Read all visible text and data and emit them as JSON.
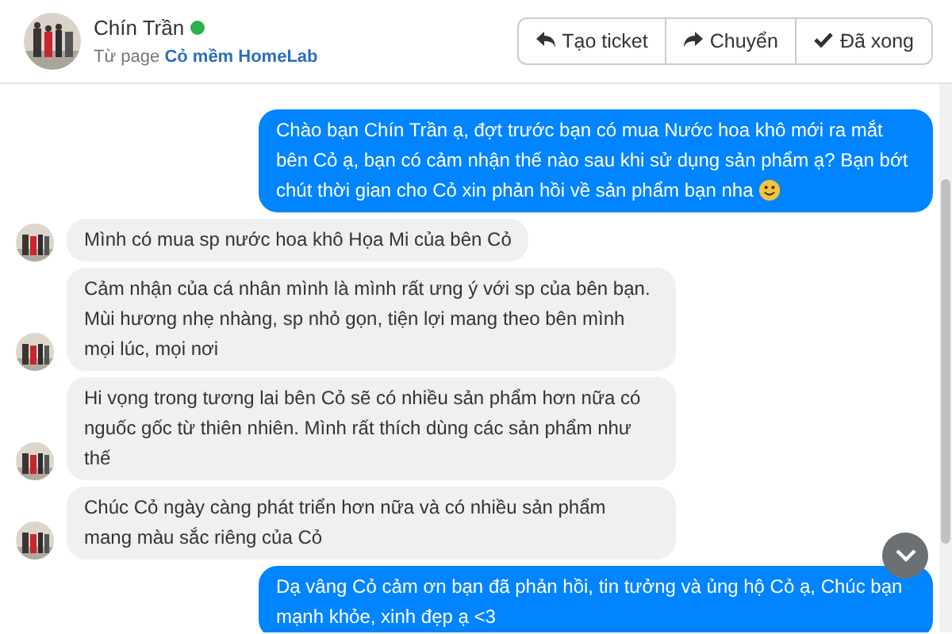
{
  "contact": {
    "name": "Chín Trần",
    "online": true,
    "page_prefix": "Từ page",
    "page_name": "Cỏ mềm HomeLab"
  },
  "buttons": [
    {
      "label": "Tạo ticket",
      "kind": "reply"
    },
    {
      "label": "Chuyển",
      "kind": "forward"
    },
    {
      "label": "Đã xong",
      "kind": "check"
    }
  ],
  "messages": [
    {
      "kind": "outgoing",
      "text": "Chào bạn Chín Trần ạ, đợt trước bạn có mua Nước hoa khô mới ra mắt bên Cỏ ạ, bạn có cảm nhận thế nào sau khi sử dụng sản phẩm ạ? Bạn bớt chút thời gian cho Cỏ xin phản hồi về sản phẩm bạn nha",
      "smiley": true
    },
    {
      "kind": "incoming",
      "text": "Mình có mua sp nước hoa khô Họa Mi của bên Cỏ"
    },
    {
      "kind": "incoming",
      "text": "Cảm nhận của cá nhân mình là mình rất ưng ý với sp của bên bạn. Mùi hương nhẹ nhàng, sp nhỏ gọn, tiện lợi mang theo bên mình mọi lúc, mọi nơi"
    },
    {
      "kind": "incoming",
      "text": "Hi vọng trong tương lai bên Cỏ sẽ có nhiều sản phẩm hơn nữa có nguốc gốc từ thiên nhiên. Mình rất thích dùng các sản phẩm như thế"
    },
    {
      "kind": "incoming",
      "text": "Chúc Cỏ ngày càng phát triển hơn nữa và có nhiều sản phẩm mang màu sắc riêng của Cỏ"
    },
    {
      "kind": "outgoing",
      "text": "Dạ vâng Cỏ cảm ơn bạn đã phản hồi, tin tưởng và ủng hộ Cỏ ạ, Chúc bạn mạnh khỏe, xinh đẹp ạ <3"
    }
  ]
}
